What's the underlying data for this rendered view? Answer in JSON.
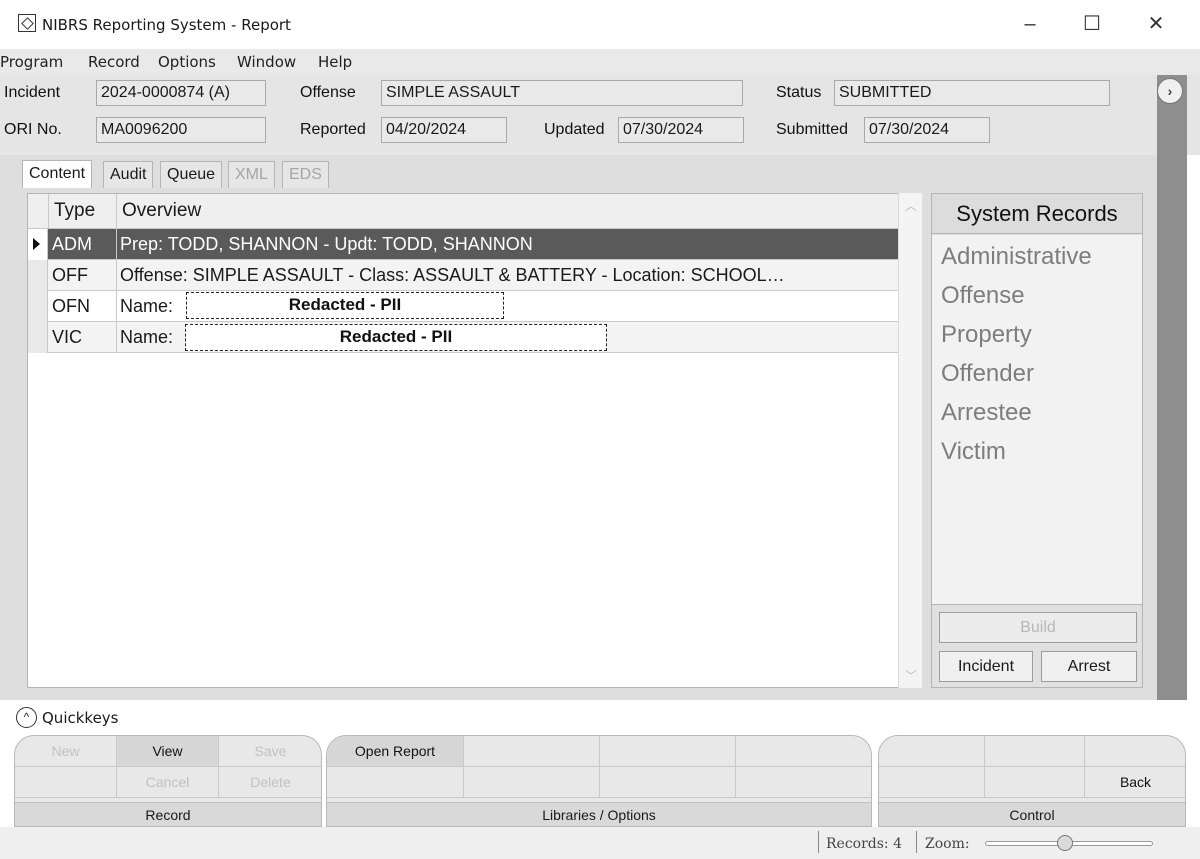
{
  "window": {
    "title": "NIBRS Reporting System - Report",
    "minimize": "–",
    "maximize": "☐",
    "close": "✕"
  },
  "menu": [
    "Program",
    "Record",
    "Options",
    "Window",
    "Help"
  ],
  "header": {
    "incident_label": "Incident",
    "incident_value": "2024-0000874 (A)",
    "offense_label": "Offense",
    "offense_value": "SIMPLE ASSAULT",
    "status_label": "Status",
    "status_value": "SUBMITTED",
    "ori_label": "ORI No.",
    "ori_value": "MA0096200",
    "reported_label": "Reported",
    "reported_value": "04/20/2024",
    "updated_label": "Updated",
    "updated_value": "07/30/2024",
    "submitted_label": "Submitted",
    "submitted_value": "07/30/2024"
  },
  "tabs": [
    {
      "label": "Content",
      "state": "active"
    },
    {
      "label": "Audit",
      "state": "normal"
    },
    {
      "label": "Queue",
      "state": "normal"
    },
    {
      "label": "XML",
      "state": "disabled"
    },
    {
      "label": "EDS",
      "state": "disabled"
    }
  ],
  "grid": {
    "columns": [
      "Type",
      "Overview"
    ],
    "rows": [
      {
        "type": "ADM",
        "overview": "Prep: TODD, SHANNON - Updt: TODD, SHANNON",
        "selected": true
      },
      {
        "type": "OFF",
        "overview": "Offense: SIMPLE ASSAULT - Class: ASSAULT & BATTERY - Location: SCHOOL…"
      },
      {
        "type": "OFN",
        "overview": "Name:",
        "redaction": "Redacted - PII"
      },
      {
        "type": "VIC",
        "overview": "Name:",
        "redaction": "Redacted - PII"
      }
    ]
  },
  "system_records": {
    "title": "System Records",
    "items": [
      "Administrative",
      "Offense",
      "Property",
      "Offender",
      "Arrestee",
      "Victim"
    ],
    "build_label": "Build",
    "incident_label": "Incident",
    "arrest_label": "Arrest"
  },
  "quickkeys": {
    "label": "Quickkeys",
    "record": {
      "new": "New",
      "view": "View",
      "save": "Save",
      "cancel": "Cancel",
      "delete": "Delete",
      "footer": "Record"
    },
    "libraries": {
      "open_report": "Open Report",
      "footer": "Libraries / Options"
    },
    "control": {
      "back": "Back",
      "footer": "Control"
    }
  },
  "status": {
    "records": "Records: 4",
    "zoom_label": "Zoom:"
  }
}
